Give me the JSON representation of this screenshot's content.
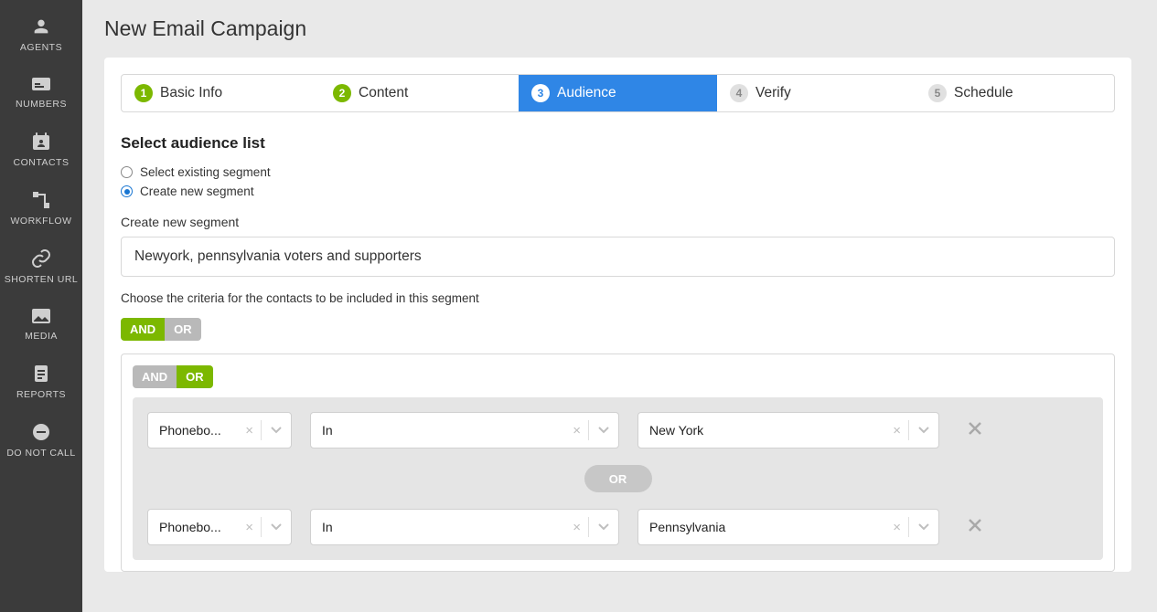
{
  "sidebar": {
    "items": [
      {
        "label": "AGENTS"
      },
      {
        "label": "NUMBERS"
      },
      {
        "label": "CONTACTS"
      },
      {
        "label": "WORKFLOW"
      },
      {
        "label": "SHORTEN URL"
      },
      {
        "label": "MEDIA"
      },
      {
        "label": "REPORTS"
      },
      {
        "label": "DO NOT CALL"
      }
    ]
  },
  "page": {
    "title": "New Email Campaign"
  },
  "steps": {
    "tabs": [
      {
        "num": "1",
        "label": "Basic Info"
      },
      {
        "num": "2",
        "label": "Content"
      },
      {
        "num": "3",
        "label": "Audience"
      },
      {
        "num": "4",
        "label": "Verify"
      },
      {
        "num": "5",
        "label": "Schedule"
      }
    ]
  },
  "audience": {
    "heading": "Select audience list",
    "radio_existing": "Select existing segment",
    "radio_create": "Create new segment",
    "create_label": "Create new segment",
    "segment_name": "Newyork, pennsylvania voters and supporters",
    "criteria_help": "Choose the criteria for the contacts to be included in this segment",
    "outer_and": "AND",
    "outer_or": "OR",
    "inner_and": "AND",
    "inner_or": "OR",
    "or_pill": "OR",
    "rows": [
      {
        "field": "Phonebo...",
        "op": "In",
        "value": "New York"
      },
      {
        "field": "Phonebo...",
        "op": "In",
        "value": "Pennsylvania"
      }
    ]
  }
}
